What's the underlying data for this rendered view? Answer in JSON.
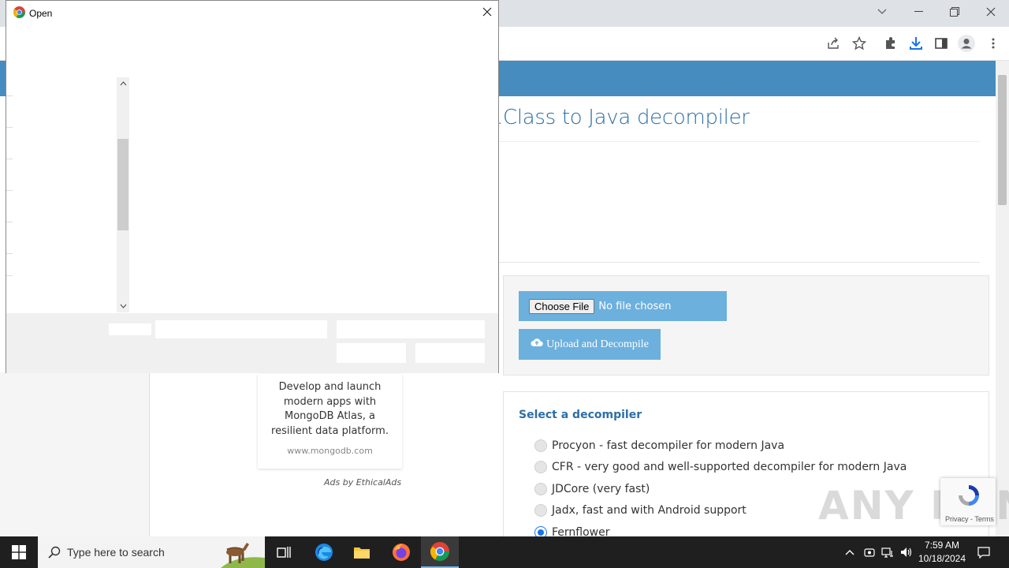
{
  "dialog": {
    "title": "Open"
  },
  "page": {
    "title": ".Class to Java decompiler",
    "file_input": {
      "button_label": "Choose File",
      "status": "No file chosen"
    },
    "upload_button": "Upload and Decompile",
    "decompiler_section": {
      "title": "Select a decompiler",
      "options": [
        {
          "label": "Procyon - fast decompiler for modern Java",
          "checked": false
        },
        {
          "label": "CFR - very good and well-supported decompiler for modern Java",
          "checked": false
        },
        {
          "label": "JDCore (very fast)",
          "checked": false
        },
        {
          "label": "Jadx, fast and with Android support",
          "checked": false
        },
        {
          "label": "Fernflower",
          "checked": true
        }
      ]
    },
    "ad": {
      "text_lines": [
        "Develop and launch",
        "modern apps with",
        "MongoDB Atlas, a",
        "resilient data platform."
      ],
      "url": "www.mongodb.com",
      "attribution": "Ads by EthicalAds"
    },
    "recaptcha_links": "Privacy - Terms",
    "watermark": "ANY RUN"
  },
  "taskbar": {
    "search_placeholder": "Type here to search",
    "time": "7:59 AM",
    "date": "10/18/2024"
  },
  "colors": {
    "header_blue": "#468cbf",
    "button_blue": "#6cb0de",
    "title_blue": "#2c6fa6"
  }
}
